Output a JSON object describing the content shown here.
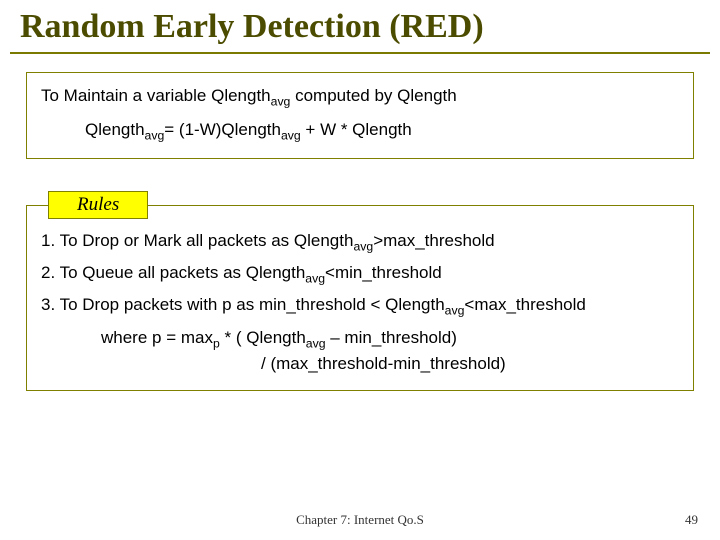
{
  "title": "Random Early Detection (RED)",
  "box1": {
    "line1_a": "To Maintain a variable Qlength",
    "line1_sub": "avg",
    "line1_b": " computed by Qlength",
    "formula_a": "Qlength",
    "formula_sub1": "avg",
    "formula_b": "= (1-W)Qlength",
    "formula_sub2": "avg",
    "formula_c": " + W * Qlength"
  },
  "rules_label": "Rules",
  "rules": {
    "r1_a": "1. To Drop or Mark all packets as Qlength",
    "r1_sub": "avg",
    "r1_b": ">max_threshold",
    "r2_a": "2. To Queue all packets as Qlength",
    "r2_sub": "avg",
    "r2_b": "<min_threshold",
    "r3_a": "3. To Drop packets with p as min_threshold < Qlength",
    "r3_sub": "avg",
    "r3_b": "<max_threshold",
    "where_a": "where p = max",
    "where_sub1": "p",
    "where_b": " * ( Qlength",
    "where_sub2": "avg",
    "where_c": " – min_threshold)",
    "where_line2": "/ (max_threshold-min_threshold)"
  },
  "footer": {
    "center": "Chapter 7: Internet Qo.S",
    "page": "49"
  }
}
